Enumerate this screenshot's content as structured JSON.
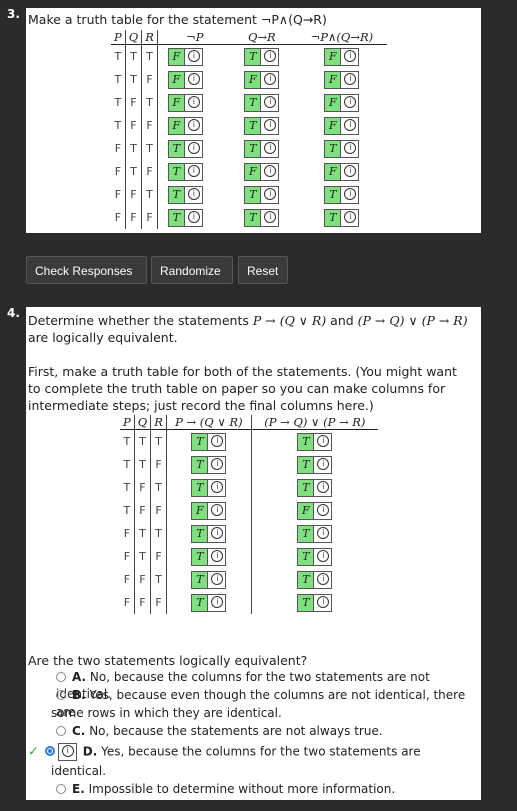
{
  "q3": {
    "number": "3.",
    "prompt": "Make a truth table for the statement ¬P∧(Q→R)",
    "headers": [
      "P",
      "Q",
      "R",
      "¬P",
      "Q→R",
      "¬P∧(Q→R)"
    ],
    "rows": [
      {
        "p": "T",
        "q": "T",
        "r": "T",
        "c1": "F",
        "c2": "T",
        "c3": "F"
      },
      {
        "p": "T",
        "q": "T",
        "r": "F",
        "c1": "F",
        "c2": "F",
        "c3": "F"
      },
      {
        "p": "T",
        "q": "F",
        "r": "T",
        "c1": "F",
        "c2": "T",
        "c3": "F"
      },
      {
        "p": "T",
        "q": "F",
        "r": "F",
        "c1": "F",
        "c2": "T",
        "c3": "F"
      },
      {
        "p": "F",
        "q": "T",
        "r": "T",
        "c1": "T",
        "c2": "T",
        "c3": "T"
      },
      {
        "p": "F",
        "q": "T",
        "r": "F",
        "c1": "T",
        "c2": "F",
        "c3": "F"
      },
      {
        "p": "F",
        "q": "F",
        "r": "T",
        "c1": "T",
        "c2": "T",
        "c3": "T"
      },
      {
        "p": "F",
        "q": "F",
        "r": "F",
        "c1": "T",
        "c2": "T",
        "c3": "T"
      }
    ]
  },
  "buttons": {
    "check": "Check Responses",
    "randomize": "Randomize",
    "reset": "Reset"
  },
  "q4": {
    "number": "4.",
    "prompt_a": "Determine whether the statements ",
    "stmt1": "P → (Q ∨ R)",
    "prompt_b": " and ",
    "stmt2": "(P → Q) ∨ (P → R)",
    "prompt_c": "are logically equivalent.",
    "instructions": "First, make a truth table for both of the statements. (You might want to complete the truth table on paper so you can make columns for intermediate steps; just record the final columns here.)",
    "headers": [
      "P",
      "Q",
      "R",
      "P → (Q ∨ R)",
      "(P → Q) ∨ (P → R)"
    ],
    "rows": [
      {
        "p": "T",
        "q": "T",
        "r": "T",
        "c1": "T",
        "c2": "T"
      },
      {
        "p": "T",
        "q": "T",
        "r": "F",
        "c1": "T",
        "c2": "T"
      },
      {
        "p": "T",
        "q": "F",
        "r": "T",
        "c1": "T",
        "c2": "T"
      },
      {
        "p": "T",
        "q": "F",
        "r": "F",
        "c1": "F",
        "c2": "F"
      },
      {
        "p": "F",
        "q": "T",
        "r": "T",
        "c1": "T",
        "c2": "T"
      },
      {
        "p": "F",
        "q": "T",
        "r": "F",
        "c1": "T",
        "c2": "T"
      },
      {
        "p": "F",
        "q": "F",
        "r": "T",
        "c1": "T",
        "c2": "T"
      },
      {
        "p": "F",
        "q": "F",
        "r": "F",
        "c1": "T",
        "c2": "T"
      }
    ],
    "question": "Are the two statements logically equivalent?",
    "choices": [
      {
        "letter": "A.",
        "text": "No, because the columns for the two statements are not identical."
      },
      {
        "letter": "B.",
        "text": "Yes, because even though the columns are not identical, there are"
      },
      {
        "letter": "C.",
        "text": "No, because the statements are not always true."
      },
      {
        "letter": "D.",
        "text": "Yes, because the columns for the two statements are"
      },
      {
        "letter": "E.",
        "text": "Impossible to determine without more information."
      }
    ],
    "choice_b_cont": "some rows in which they are identical.",
    "choice_d_cont": "identical.",
    "check_mark": "✓"
  }
}
